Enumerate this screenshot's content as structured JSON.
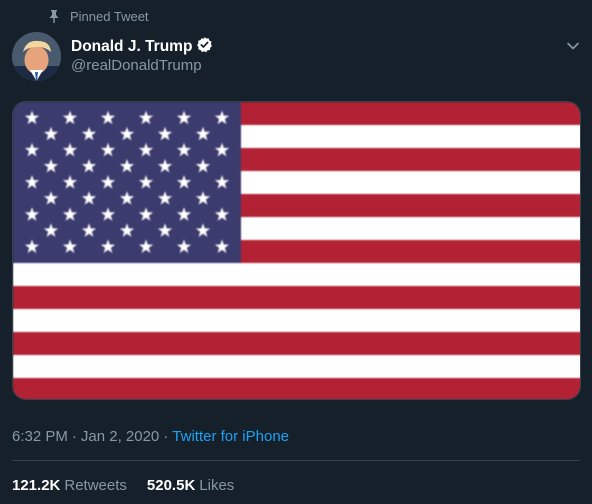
{
  "pinned_label": "Pinned Tweet",
  "user": {
    "name": "Donald J. Trump",
    "handle": "@realDonaldTrump",
    "verified": true
  },
  "meta": {
    "time": "6:32 PM",
    "sep1": "·",
    "date": "Jan 2, 2020",
    "sep2": "·",
    "source": "Twitter for iPhone"
  },
  "stats": {
    "retweets_count": "121.2K",
    "retweets_label": "Retweets",
    "likes_count": "520.5K",
    "likes_label": "Likes"
  },
  "media": {
    "type": "image",
    "subject": "US flag",
    "stripe_red": "#b22234",
    "stripe_white": "#ffffff",
    "canton_blue": "#3c3b6e"
  },
  "colors": {
    "background": "#15202b",
    "secondary_text": "#8899a6",
    "link": "#1da1f2",
    "verified_badge": "#ffffff"
  },
  "icons": [
    "pin-icon",
    "verified-badge-icon",
    "chevron-down-icon"
  ]
}
